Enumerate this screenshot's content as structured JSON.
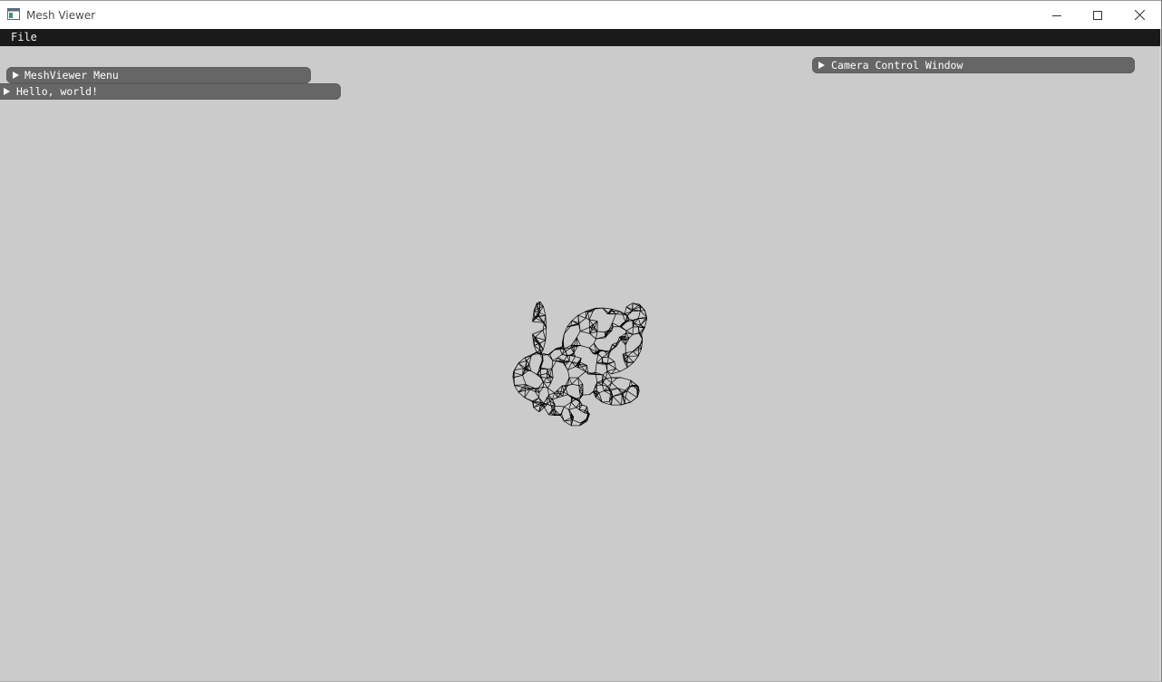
{
  "window": {
    "title": "Mesh Viewer",
    "icon": "app-window-icon",
    "controls": {
      "minimize_icon": "minimize-icon",
      "maximize_icon": "maximize-icon",
      "close_icon": "close-icon"
    }
  },
  "menubar": {
    "items": [
      {
        "label": "File"
      }
    ]
  },
  "panels": {
    "meshviewer_menu": {
      "title": "MeshViewer Menu",
      "collapsed": true
    },
    "hello_world": {
      "title": "Hello, world!",
      "collapsed": true
    },
    "camera_control": {
      "title": "Camera Control Window",
      "collapsed": true
    }
  },
  "viewport": {
    "background_color": "#cbcbcb",
    "mesh": {
      "render_mode": "wireframe",
      "model": "bunny",
      "line_color": "#000000"
    }
  },
  "colors": {
    "menubar_bg": "#1a1a1a",
    "collapsed_window_bg": "#666666",
    "title_text": "#4a4a4a"
  }
}
